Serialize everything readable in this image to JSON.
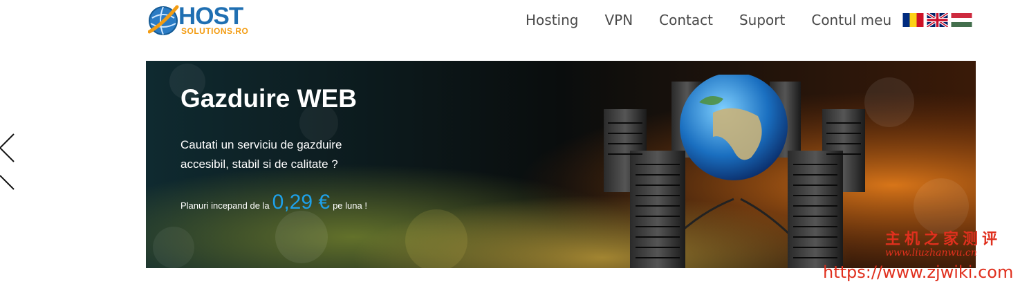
{
  "header": {
    "logo": {
      "main": "HOST",
      "sub": "SOLUTIONS.RO"
    },
    "nav": [
      {
        "label": "Hosting"
      },
      {
        "label": "VPN"
      },
      {
        "label": "Contact"
      },
      {
        "label": "Suport"
      },
      {
        "label": "Contul meu"
      }
    ],
    "languages": [
      "romania-flag-icon",
      "uk-flag-icon",
      "hungary-flag-icon"
    ]
  },
  "banner": {
    "title": "Gazduire WEB",
    "text_line1": "Cautati un serviciu de gazduire",
    "text_line2": "accesibil, stabil si de calitate ?",
    "price_prefix": "Planuri incepand de la",
    "price_value": "0,29 €",
    "price_suffix": "pe luna !"
  },
  "watermark": {
    "chinese": "主机之家测评",
    "pinyin": "www.liuzhanwu.cn",
    "url": "https://www.zjwiki.com"
  },
  "colors": {
    "accent": "#1ea0e8",
    "logo_blue": "#1f6fb2",
    "logo_orange": "#f39c12",
    "watermark": "#e0301e"
  }
}
